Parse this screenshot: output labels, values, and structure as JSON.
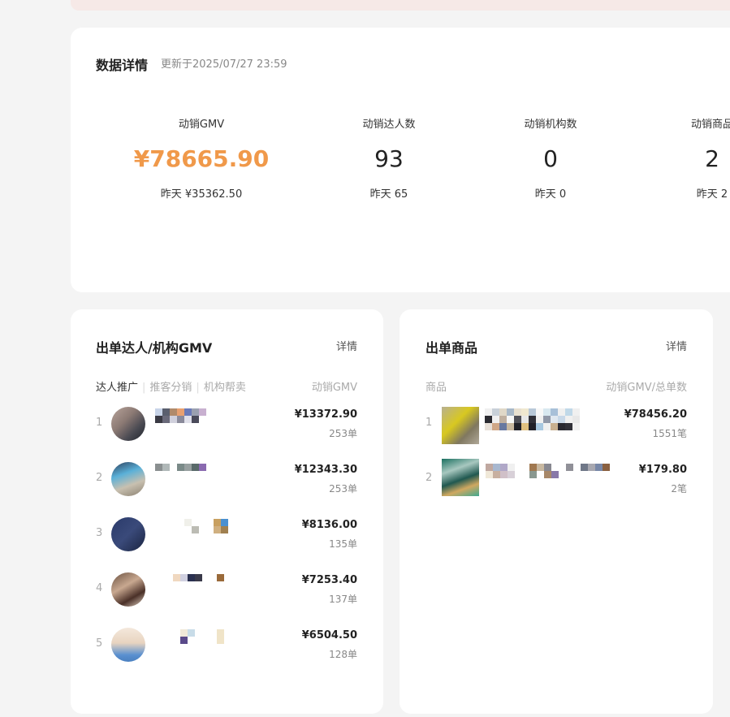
{
  "metrics_card": {
    "title": "数据详情",
    "updated": "更新于2025/07/27 23:59",
    "metrics": [
      {
        "label": "动销GMV",
        "value": "¥78665.90",
        "yesterday": "昨天  ¥35362.50"
      },
      {
        "label": "动销达人数",
        "value": "93",
        "yesterday": "昨天  65"
      },
      {
        "label": "动销机构数",
        "value": "0",
        "yesterday": "昨天  0"
      },
      {
        "label": "动销商品",
        "value": "2",
        "yesterday": "昨天  2"
      }
    ]
  },
  "creators_card": {
    "title": "出单达人/机构GMV",
    "detail_link": "详情",
    "tabs": [
      "达人推广",
      "推客分销",
      "机构帮卖"
    ],
    "column_header": "动销GMV",
    "rows": [
      {
        "rank": "1",
        "amount": "¥13372.90",
        "orders": "253单"
      },
      {
        "rank": "2",
        "amount": "¥12343.30",
        "orders": "253单"
      },
      {
        "rank": "3",
        "amount": "¥8136.00",
        "orders": "135单"
      },
      {
        "rank": "4",
        "amount": "¥7253.40",
        "orders": "137单"
      },
      {
        "rank": "5",
        "amount": "¥6504.50",
        "orders": "128单"
      }
    ]
  },
  "products_card": {
    "title": "出单商品",
    "detail_link": "详情",
    "column_left": "商品",
    "column_right": "动销GMV/总单数",
    "rows": [
      {
        "rank": "1",
        "amount": "¥78456.20",
        "orders": "1551笔"
      },
      {
        "rank": "2",
        "amount": "¥179.80",
        "orders": "2笔"
      }
    ]
  },
  "colors": {
    "accent": "#f0994a",
    "page_bg": "#f4f4f4",
    "banner": "#f6e9e7"
  }
}
